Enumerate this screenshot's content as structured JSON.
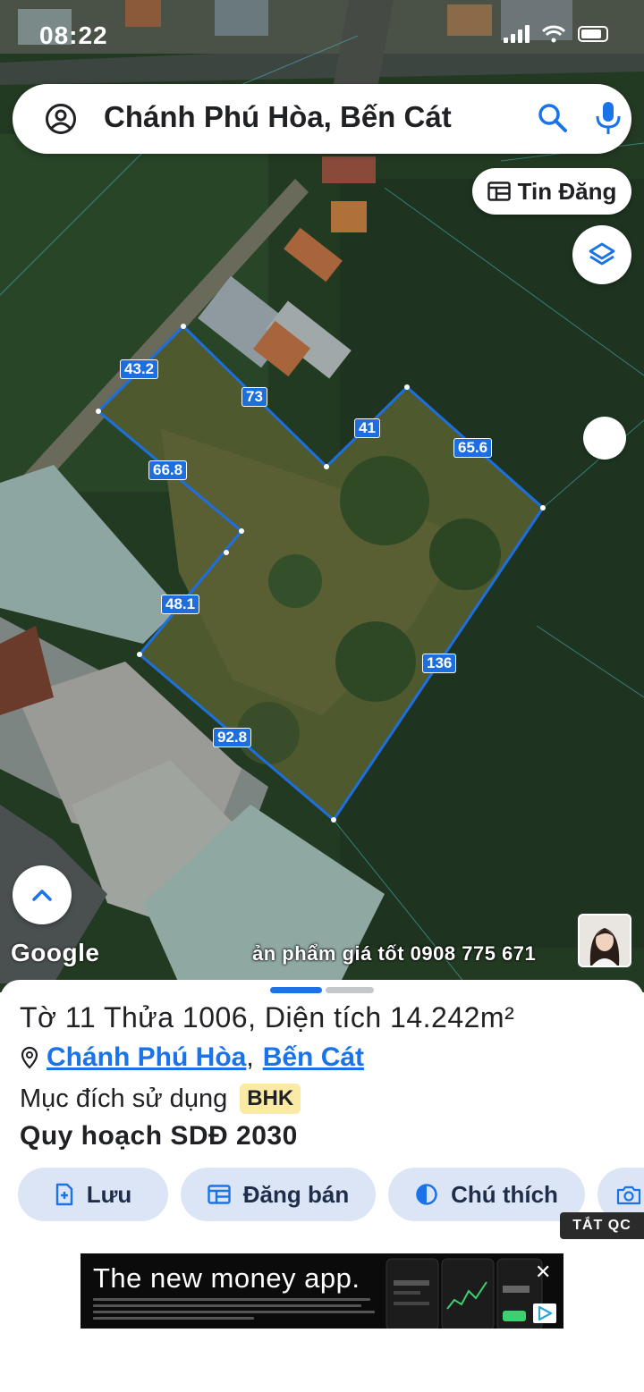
{
  "status_bar": {
    "time": "08:22"
  },
  "search": {
    "query": "Chánh Phú Hòa, Bến Cát"
  },
  "buttons": {
    "tin_dang": "Tin Đăng"
  },
  "map": {
    "edge_labels": [
      "43.2",
      "73",
      "41",
      "65.6",
      "66.8",
      "48.1",
      "136",
      "92.8"
    ],
    "google_logo": "Google",
    "promo_text": "ản phẩm giá tốt 0908 775 671"
  },
  "parcel": {
    "title": "Tờ 11 Thửa 1006, Diện tích 14.242m²",
    "location": {
      "commune": "Chánh Phú Hòa",
      "separator": ",",
      "district": "Bến Cát"
    },
    "purpose_label": "Mục đích sử dụng",
    "purpose_code": "BHK",
    "planning": "Quy hoạch SDĐ 2030"
  },
  "actions": {
    "save": "Lưu",
    "post_sale": "Đăng bán",
    "legend": "Chú thích"
  },
  "ad": {
    "hide_label": "TẮT QC",
    "headline": "The new money app."
  },
  "colors": {
    "accent": "#1a73e8",
    "plot_line": "#1d6fe0",
    "badge_bg": "#fbeaa6",
    "action_bg": "#dbe5f6"
  }
}
